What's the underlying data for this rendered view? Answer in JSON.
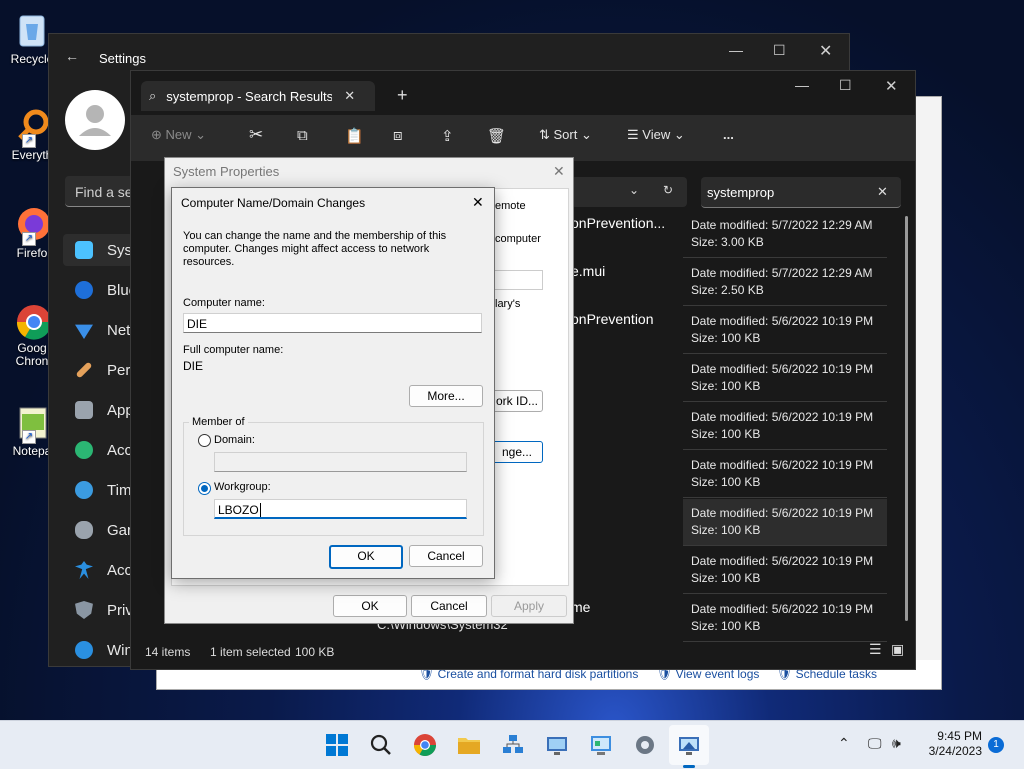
{
  "desktop": {
    "icons": [
      {
        "label": "Recycle",
        "icon": "recycle-bin-icon"
      },
      {
        "label": "Everyth",
        "icon": "search-magnifier-icon"
      },
      {
        "label": "Firefo",
        "icon": "firefox-icon"
      },
      {
        "label": "Goog Chron",
        "icon": "chrome-icon"
      },
      {
        "label": "Notepa",
        "icon": "notepad-icon"
      }
    ]
  },
  "settings": {
    "title": "Settings",
    "search_placeholder": "Find a se",
    "nav": [
      {
        "label": "Syst",
        "icon": "monitor-icon"
      },
      {
        "label": "Blue",
        "icon": "bluetooth-icon"
      },
      {
        "label": "Net",
        "icon": "wifi-icon"
      },
      {
        "label": "Pers",
        "icon": "brush-icon"
      },
      {
        "label": "App",
        "icon": "apps-icon"
      },
      {
        "label": "Acc",
        "icon": "person-icon"
      },
      {
        "label": "Tim",
        "icon": "globe-clock-icon"
      },
      {
        "label": "Gar",
        "icon": "gamepad-icon"
      },
      {
        "label": "Acc",
        "icon": "accessibility-icon"
      },
      {
        "label": "Priv",
        "icon": "shield-icon"
      },
      {
        "label": "Win",
        "icon": "update-icon"
      }
    ]
  },
  "explorer": {
    "tab_title": "systemprop - Search Results i",
    "toolbar": {
      "new": "New",
      "sort": "Sort",
      "view": "View",
      "more": "..."
    },
    "search_value": "systemprop",
    "rows": [
      {
        "name": "onPrevention...",
        "modified": "Date modified: 5/7/2022 12:29 AM",
        "size": "Size: 3.00 KB"
      },
      {
        "name": "e.mui",
        "modified": "Date modified: 5/7/2022 12:29 AM",
        "size": "Size: 2.50 KB"
      },
      {
        "name": "onPrevention",
        "modified": "Date modified: 5/6/2022 10:19 PM",
        "size": "Size: 100 KB"
      },
      {
        "name": "",
        "modified": "Date modified: 5/6/2022 10:19 PM",
        "size": "Size: 100 KB"
      },
      {
        "name": "",
        "modified": "Date modified: 5/6/2022 10:19 PM",
        "size": "Size: 100 KB"
      },
      {
        "name": "",
        "modified": "Date modified: 5/6/2022 10:19 PM",
        "size": "Size: 100 KB"
      },
      {
        "name": "",
        "modified": "Date modified: 5/6/2022 10:19 PM",
        "size": "Size: 100 KB"
      },
      {
        "name": "",
        "modified": "Date modified: 5/6/2022 10:19 PM",
        "size": "Size: 100 KB"
      },
      {
        "name": "me",
        "modified": "Date modified: 5/6/2022 10:19 PM",
        "size": "Size: 100 KB"
      }
    ],
    "path_fragment": "C:\\Windows\\System32",
    "status": {
      "items": "14 items",
      "selected": "1 item selected",
      "size": "100 KB"
    },
    "bottom_links": [
      "Create and format hard disk partitions",
      "View event logs",
      "Schedule tasks"
    ]
  },
  "system_properties": {
    "title": "System Properties",
    "fragments": {
      "remote": "emote",
      "computer": "computer",
      "library": "lary's",
      "network_id": "ork ID...",
      "change": "nge..."
    },
    "buttons": {
      "ok": "OK",
      "cancel": "Cancel",
      "apply": "Apply"
    }
  },
  "computer_name_dialog": {
    "title": "Computer Name/Domain Changes",
    "description": "You can change the name and the membership of this computer. Changes might affect access to network resources.",
    "computer_name_label": "Computer name:",
    "computer_name_value": "DIE",
    "full_name_label": "Full computer name:",
    "full_name_value": "DIE",
    "more_button": "More...",
    "member_of_label": "Member of",
    "domain_label": "Domain:",
    "domain_value": "",
    "workgroup_label": "Workgroup:",
    "workgroup_value": "LBOZO",
    "selected_membership": "Workgroup",
    "ok_button": "OK",
    "cancel_button": "Cancel"
  },
  "taskbar": {
    "apps": [
      "start-icon",
      "search-icon",
      "chrome-icon",
      "file-explorer-icon",
      "network-app-icon",
      "remote-desktop-icon",
      "control-panel-icon",
      "settings-icon",
      "system-properties-icon"
    ],
    "time": "9:45 PM",
    "date": "3/24/2023",
    "notification_count": "1"
  },
  "colors": {
    "accent": "#0067c0",
    "dark_bg": "#191919",
    "dialog_bg": "#f0f0f0"
  }
}
